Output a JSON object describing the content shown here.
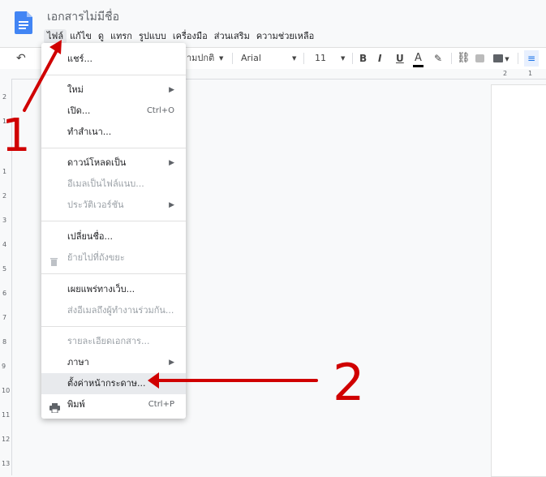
{
  "doc": {
    "title": "เอกสารไม่มีชื่อ"
  },
  "menubar": [
    "ไฟล์",
    "แก้ไข",
    "ดู",
    "แทรก",
    "รูปแบบ",
    "เครื่องมือ",
    "ส่วนเสริม",
    "ความช่วยเหลือ"
  ],
  "toolbar": {
    "style": "ามปกติ",
    "font": "Arial",
    "size": "11",
    "bold": "B",
    "italic": "I",
    "underline": "U",
    "textcolor": "A"
  },
  "ruler": {
    "h": [
      "2",
      "1"
    ],
    "v": [
      "2",
      "1",
      "1",
      "2",
      "3",
      "4",
      "5",
      "6",
      "7",
      "8",
      "9",
      "10",
      "11",
      "12",
      "13"
    ]
  },
  "menu": {
    "share": "แชร์...",
    "new": "ใหม่",
    "open": "เปิด...",
    "open_sc": "Ctrl+O",
    "copy": "ทำสำเนา...",
    "download": "ดาวน์โหลดเป็น",
    "email_attach": "อีเมลเป็นไฟล์แนบ...",
    "version": "ประวัติเวอร์ชัน",
    "rename": "เปลี่ยนชื่อ...",
    "trash": "ย้ายไปที่ถังขยะ",
    "publish": "เผยแพร่ทางเว็บ...",
    "email_collab": "ส่งอีเมลถึงผู้ทำงานร่วมกัน...",
    "details": "รายละเอียดเอกสาร...",
    "language": "ภาษา",
    "page_setup": "ตั้งค่าหน้ากระดาษ...",
    "print": "พิมพ์",
    "print_sc": "Ctrl+P"
  },
  "annotations": {
    "one": "1",
    "two": "2"
  },
  "colors": {
    "accent": "#d00000",
    "docs_blue": "#4285f4",
    "text_color_bar": "#000000"
  }
}
